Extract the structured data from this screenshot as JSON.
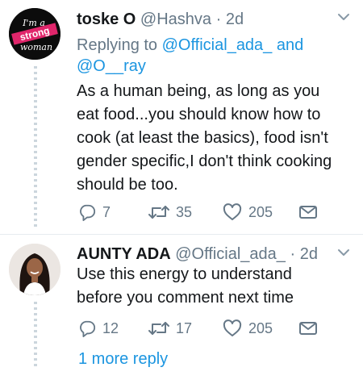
{
  "tweet1": {
    "display_name": "toske O",
    "handle": "@Hashva",
    "separator": "·",
    "time": "2d",
    "replying_prefix": "Replying to",
    "reply_user_1": "@Official_ada_",
    "reply_and": "and",
    "reply_user_2": "@O__ray",
    "text_lines": [
      "As a human being, as long as you",
      "eat food...you should know how to",
      "cook (at least the basics), food isn't",
      "gender specific,I don't think cooking",
      "should be too."
    ],
    "replies": "7",
    "retweets": "35",
    "likes": "205",
    "avatar_words": [
      "I'm a",
      "strong",
      "woman"
    ]
  },
  "tweet2": {
    "display_name": "AUNTY ADA",
    "handle": "@Official_ada_",
    "separator": "·",
    "time": "2d",
    "text_lines": [
      "Use this energy to understand",
      "before you comment next time"
    ],
    "replies": "12",
    "retweets": "17",
    "likes": "205"
  },
  "more_replies": "1 more reply",
  "colors": {
    "link": "#1b95e0",
    "muted": "#657786",
    "text": "#14171a"
  },
  "icons": {
    "reply": "reply-icon",
    "retweet": "retweet-icon",
    "like": "heart-icon",
    "dm": "envelope-icon",
    "menu": "chevron-down-icon"
  }
}
